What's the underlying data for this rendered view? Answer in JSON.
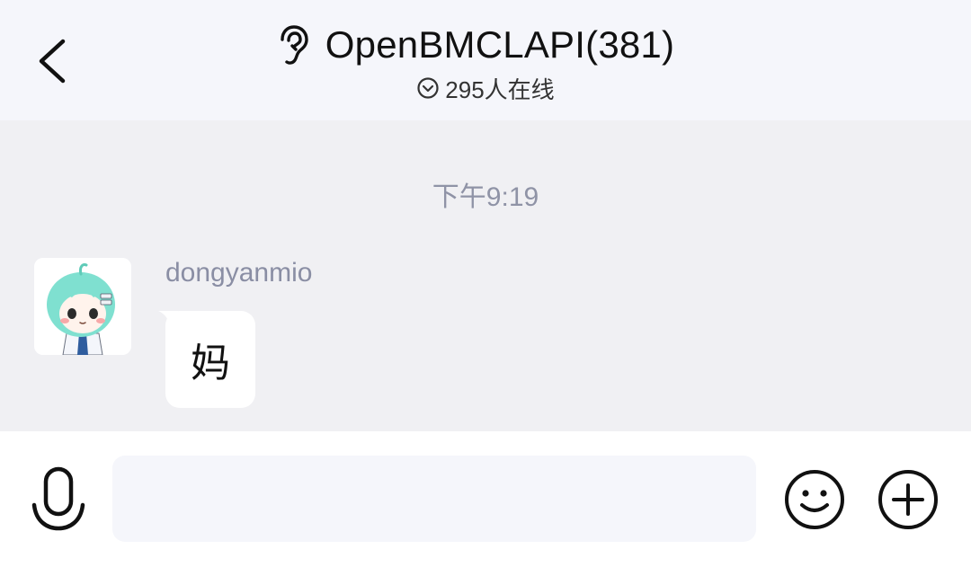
{
  "header": {
    "title": "OpenBMCLAPI(381)",
    "online_status": "295人在线",
    "back_icon": "chevron-left-icon",
    "title_icon": "ear-icon",
    "online_icon": "chevron-down-circle-icon"
  },
  "chat": {
    "timestamp": "下午9:19",
    "messages": [
      {
        "sender": "dongyanmio",
        "text": "妈",
        "avatar": "anime-avatar"
      }
    ]
  },
  "input_bar": {
    "input_value": "",
    "placeholder": "",
    "voice_icon": "microphone-icon",
    "emoji_icon": "smiley-icon",
    "more_icon": "plus-circle-icon"
  },
  "colors": {
    "header_bg": "#f5f6fb",
    "chat_bg": "#f0f0f3",
    "bubble_bg": "#ffffff",
    "muted_text": "#8f93a6"
  }
}
